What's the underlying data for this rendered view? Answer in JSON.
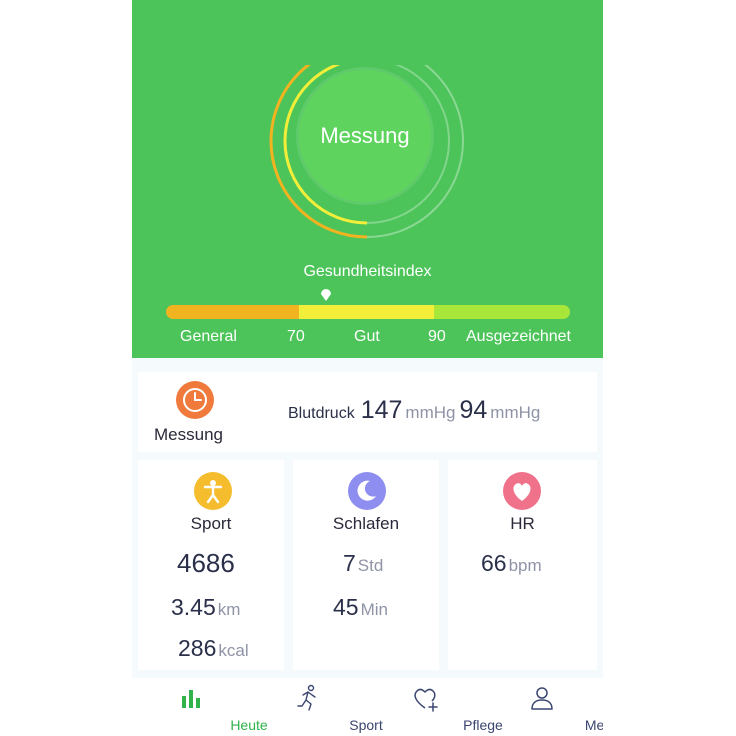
{
  "colors": {
    "header_green": "#4cc45a",
    "button_green": "#5ed45e",
    "scale_orange": "#f2b320",
    "scale_yellow": "#f3ee3a",
    "scale_green": "#a8e63a",
    "accent_nav": "#31b24a"
  },
  "header": {
    "measure_button": "Messung",
    "health_index_label": "Gesundheitsindex",
    "scale": {
      "general": "General",
      "t1": "70",
      "good": "Gut",
      "t2": "90",
      "excellent": "Ausgezeichnet"
    }
  },
  "blood_pressure": {
    "icon": "clock-icon",
    "label": "Messung",
    "name": "Blutdruck",
    "systolic": "147",
    "systolic_unit": "mmHg",
    "diastolic": "94",
    "diastolic_unit": "mmHg"
  },
  "sport": {
    "icon": "person-icon",
    "title": "Sport",
    "steps": "4686",
    "distance": "3.45",
    "distance_unit": "km",
    "calories": "286",
    "calories_unit": "kcal"
  },
  "sleep": {
    "icon": "moon-icon",
    "title": "Schlafen",
    "hours": "7",
    "hours_unit": "Std",
    "minutes": "45",
    "minutes_unit": "Min"
  },
  "heart_rate": {
    "icon": "heart-icon",
    "title": "HR",
    "value": "66",
    "unit": "bpm"
  },
  "nav": {
    "active": "Heute",
    "items": [
      {
        "label": "Heute",
        "icon": "bar-chart-icon"
      },
      {
        "label": "Sport",
        "icon": "runner-icon"
      },
      {
        "label": "Pflege",
        "icon": "heart-plus-icon"
      },
      {
        "label": "Mein",
        "icon": "user-icon"
      }
    ]
  }
}
